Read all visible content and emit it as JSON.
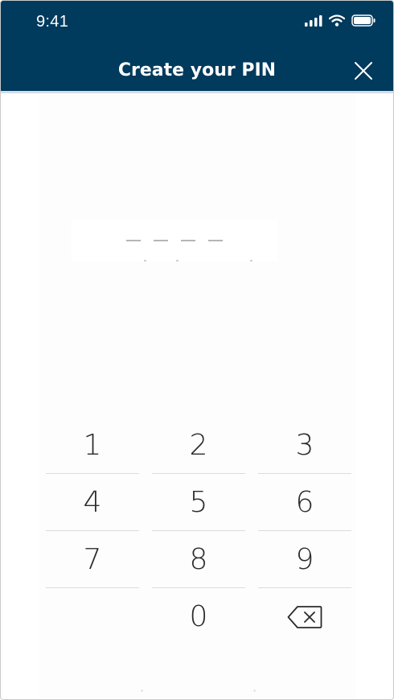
{
  "status_bar": {
    "time": "9:41",
    "icons": [
      "signal-icon",
      "wifi-icon",
      "battery-icon"
    ]
  },
  "header": {
    "title": "Create your PIN",
    "close_icon": "close-icon",
    "background_color": "#003a5d"
  },
  "pin": {
    "length": 4,
    "entered": 0
  },
  "keypad": {
    "rows": [
      [
        "1",
        "2",
        "3"
      ],
      [
        "4",
        "5",
        "6"
      ],
      [
        "7",
        "8",
        "9"
      ],
      [
        "",
        "0",
        "backspace"
      ]
    ],
    "backspace_icon": "backspace-icon"
  }
}
